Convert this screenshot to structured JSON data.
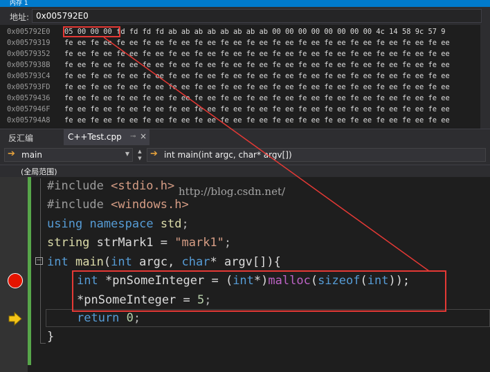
{
  "memory_window": {
    "title": "内存 1",
    "address_label": "地址:",
    "address_value": "0x005792E0",
    "rows": [
      {
        "addr": "0x005792E0",
        "bytes": "05 00 00 00 fd fd fd fd ab ab ab ab ab ab ab ab 00 00 00 00 00 00 00 00 4c 14 58 9c 57 9"
      },
      {
        "addr": "0x00579319",
        "bytes": "fe ee fe ee fe ee fe ee fe ee fe ee fe ee fe ee fe ee fe ee fe ee fe ee fe ee fe ee fe ee"
      },
      {
        "addr": "0x00579352",
        "bytes": "fe ee fe ee fe ee fe ee fe ee fe ee fe ee fe ee fe ee fe ee fe ee fe ee fe ee fe ee fe ee"
      },
      {
        "addr": "0x0057938B",
        "bytes": "fe ee fe ee fe ee fe ee fe ee fe ee fe ee fe ee fe ee fe ee fe ee fe ee fe ee fe ee fe ee"
      },
      {
        "addr": "0x005793C4",
        "bytes": "fe ee fe ee fe ee fe ee fe ee fe ee fe ee fe ee fe ee fe ee fe ee fe ee fe ee fe ee fe ee"
      },
      {
        "addr": "0x005793FD",
        "bytes": "fe ee fe ee fe ee fe ee fe ee fe ee fe ee fe ee fe ee fe ee fe ee fe ee fe ee fe ee fe ee"
      },
      {
        "addr": "0x00579436",
        "bytes": "fe ee fe ee fe ee fe ee fe ee fe ee fe ee fe ee fe ee fe ee fe ee fe ee fe ee fe ee fe ee"
      },
      {
        "addr": "0x0057946F",
        "bytes": "fe ee fe ee fe ee fe ee fe ee fe ee fe ee fe ee fe ee fe ee fe ee fe ee fe ee fe ee fe ee"
      },
      {
        "addr": "0x005794A8",
        "bytes": "fe ee fe ee fe ee fe ee fe ee fe ee fe ee fe ee fe ee fe ee fe ee fe ee fe ee fe ee fe ee"
      }
    ]
  },
  "tabs": {
    "disassembly": "反汇编",
    "active_file": "C++Test.cpp",
    "pin_glyph": "⊸",
    "close_glyph": "×"
  },
  "navigation": {
    "scope_dropdown": "main",
    "function_dropdown": "int main(int argc, char* argv[])",
    "scope_bar": "(全局范围)"
  },
  "code": {
    "line1": {
      "pp": "#include ",
      "arg": "<stdio.h>"
    },
    "line2": {
      "pp": "#include ",
      "arg": "<windows.h>"
    },
    "line3": {
      "kw1": "using",
      "kw2": "namespace",
      "ns": "std",
      "end": ";"
    },
    "line4": {
      "type": "string",
      "name": " strMark1 = ",
      "str": "\"mark1\"",
      "end": ";"
    },
    "line5": {
      "kw": "int",
      "fn": "main",
      "p1": "(",
      "kw2": "int",
      "a1": " argc, ",
      "kw3": "char",
      "a2": "* argv[]){"
    },
    "line6": {
      "kw": "int",
      "a": " *pnSomeInteger = (",
      "kw2": "int",
      "b": "*)",
      "mac": "malloc",
      "c": "(",
      "kw3": "sizeof",
      "d": "(",
      "kw4": "int",
      "e": "));"
    },
    "line7": {
      "a": "*pnSomeInteger = ",
      "num": "5",
      "end": ";"
    },
    "line8": {
      "kw": "return",
      "sp": " ",
      "num": "0",
      "end": ";"
    },
    "line9": {
      "brace": "}"
    }
  },
  "watermark": "http://blog.csdn.net/",
  "colors": {
    "highlight_red": "#e53935",
    "breakpoint_red": "#e51400",
    "current_line_arrow": "#f5c518"
  }
}
